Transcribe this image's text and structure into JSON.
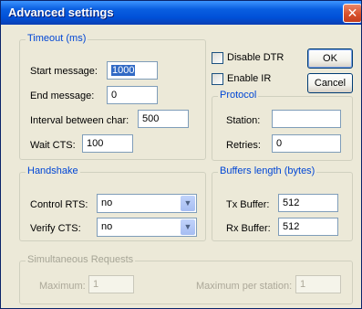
{
  "window": {
    "title": "Advanced settings",
    "close_glyph": "✕"
  },
  "timeout": {
    "legend": "Timeout (ms)",
    "start_label": "Start message:",
    "start_value": "1000",
    "end_label": "End message:",
    "end_value": "0",
    "interval_label": "Interval between char:",
    "interval_value": "500",
    "waitcts_label": "Wait CTS:",
    "waitcts_value": "100"
  },
  "options": {
    "disable_dtr": "Disable DTR",
    "enable_ir": "Enable IR"
  },
  "buttons": {
    "ok": "OK",
    "cancel": "Cancel"
  },
  "protocol": {
    "legend": "Protocol",
    "station_label": "Station:",
    "station_value": "",
    "retries_label": "Retries:",
    "retries_value": "0"
  },
  "handshake": {
    "legend": "Handshake",
    "rts_label": "Control RTS:",
    "rts_value": "no",
    "cts_label": "Verify CTS:",
    "cts_value": "no",
    "arrow_glyph": "▼"
  },
  "buffers": {
    "legend": "Buffers length (bytes)",
    "tx_label": "Tx Buffer:",
    "tx_value": "512",
    "rx_label": "Rx Buffer:",
    "rx_value": "512"
  },
  "simultaneous": {
    "legend": "Simultaneous Requests",
    "max_label": "Maximum:",
    "max_value": "1",
    "max_station_label": "Maximum per station:",
    "max_station_value": "1"
  }
}
